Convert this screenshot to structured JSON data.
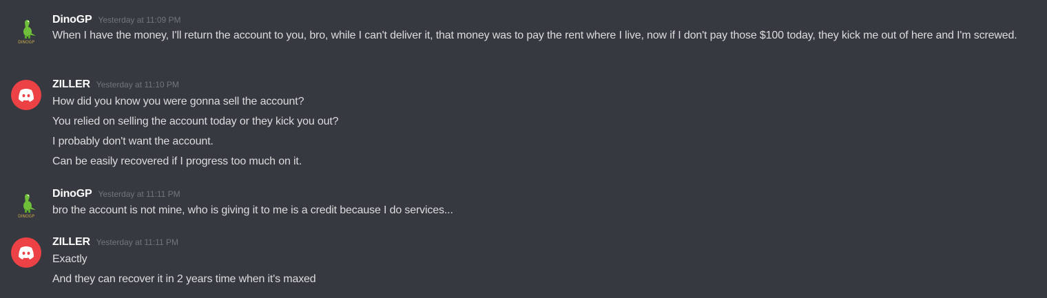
{
  "messages": [
    {
      "username": "DinoGP",
      "avatar_icon": "dino-avatar-icon",
      "timestamp": "Yesterday at 11:09 PM",
      "lines": [
        "When I have the money, I'll return the account to you, bro, while I can't deliver it, that money was to pay the rent where I live, now if I don't pay those $100 today, they kick me out of here and I'm screwed."
      ]
    },
    {
      "username": "ZILLER",
      "avatar_icon": "discord-avatar-icon",
      "timestamp": "Yesterday at 11:10 PM",
      "lines": [
        "How did you know you were gonna sell the account?",
        "You relied on selling the account today or they kick you out?",
        "I probably don't want the account.",
        "Can be easily recovered if I progress too much on it."
      ]
    },
    {
      "username": "DinoGP",
      "avatar_icon": "dino-avatar-icon",
      "timestamp": "Yesterday at 11:11 PM",
      "lines": [
        "bro the account is not mine, who is giving it to me is a credit because I do services..."
      ]
    },
    {
      "username": "ZILLER",
      "avatar_icon": "discord-avatar-icon",
      "timestamp": "Yesterday at 11:11 PM",
      "lines": [
        "Exactly",
        "And they can recover it in 2 years time when it's maxed"
      ]
    }
  ],
  "colors": {
    "background": "#36393f",
    "username": "#ffffff",
    "timestamp": "#72767d",
    "text": "#dcddde",
    "discord_avatar": "#ed4245",
    "dino_green": "#6fbf3a",
    "dino_text": "#c9a84c"
  },
  "dino_avatar_text": "DINOGP"
}
